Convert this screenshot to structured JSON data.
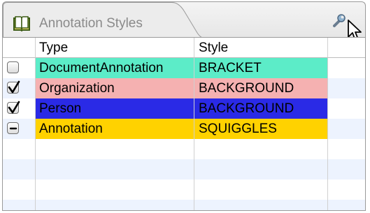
{
  "panel": {
    "title": "Annotation Styles",
    "title_icon": "book-icon",
    "tool_icon": "wrench-icon",
    "cursor_icon": "mouse-pointer-icon"
  },
  "table": {
    "columns": [
      "",
      "Type",
      "Style",
      ""
    ],
    "rows": [
      {
        "state": "unchecked",
        "type": "DocumentAnnotation",
        "style": "BRACKET",
        "color": "#5cecc8",
        "text_color": "#000000"
      },
      {
        "state": "checked",
        "type": "Organization",
        "style": "BACKGROUND",
        "color": "#f5b1b1",
        "text_color": "#000000"
      },
      {
        "state": "checked",
        "type": "Person",
        "style": "BACKGROUND",
        "color": "#2a2ae6",
        "text_color": "#000000"
      },
      {
        "state": "mixed",
        "type": "Annotation",
        "style": "SQUIGGLES",
        "color": "#ffd200",
        "text_color": "#000000"
      }
    ]
  }
}
